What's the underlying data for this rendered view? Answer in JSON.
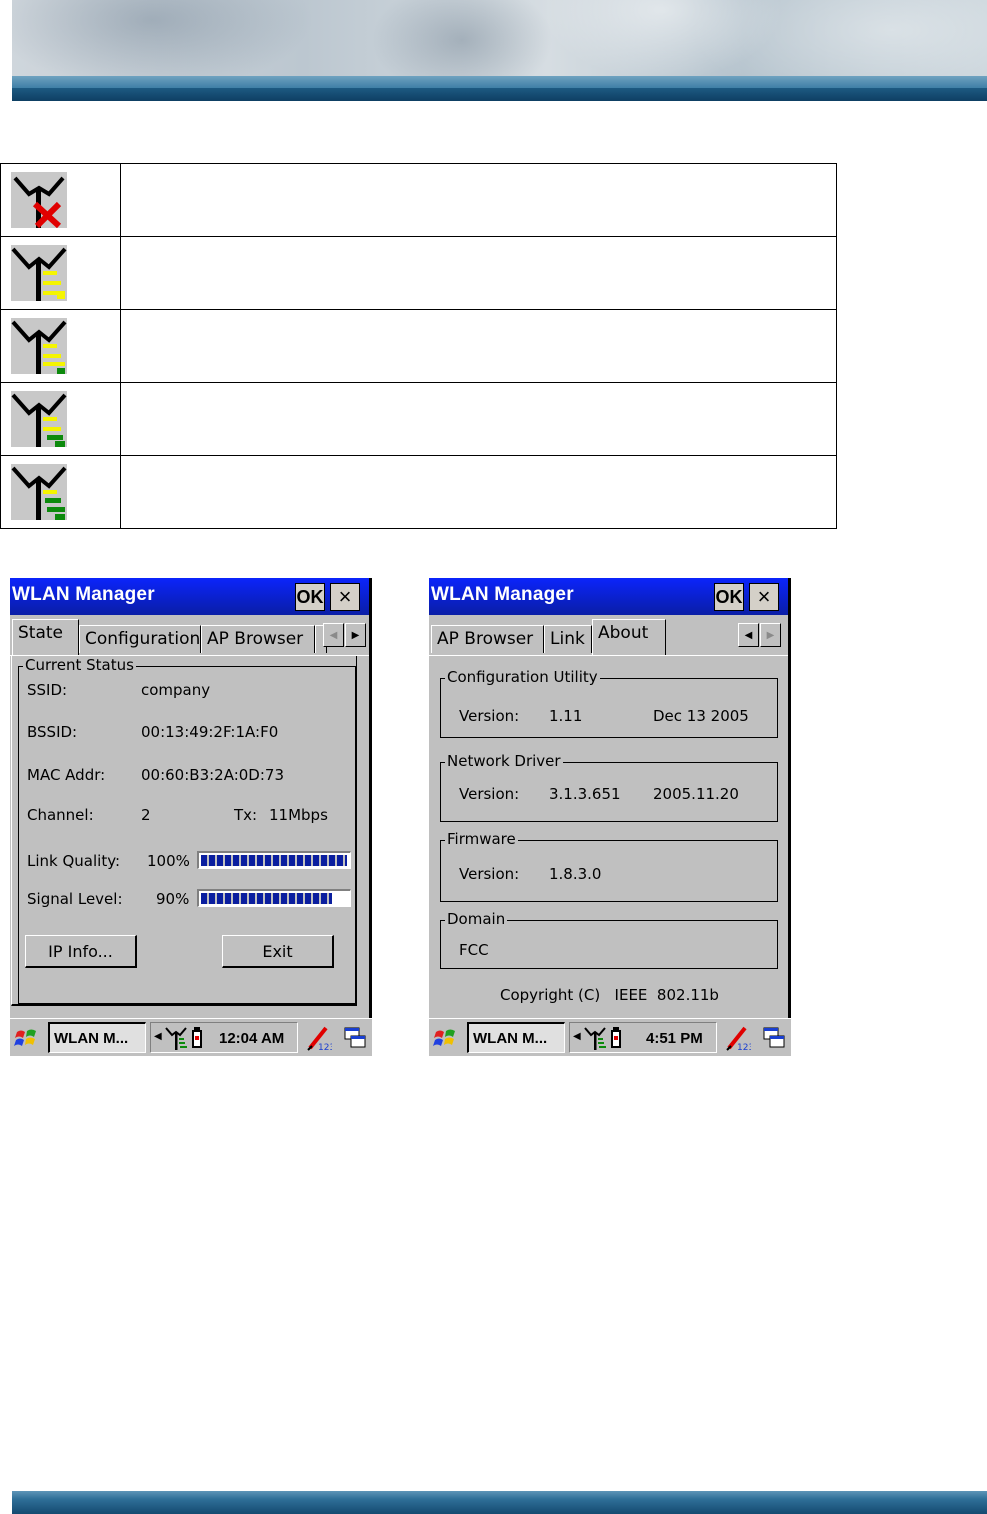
{
  "signal_levels": [
    {
      "icon": "signal-disconnected-icon",
      "description": ""
    },
    {
      "icon": "signal-bars-0-green-icon",
      "description": ""
    },
    {
      "icon": "signal-bars-1-green-icon",
      "description": ""
    },
    {
      "icon": "signal-bars-2-green-icon",
      "description": ""
    },
    {
      "icon": "signal-bars-3-green-icon",
      "description": ""
    }
  ],
  "colors": {
    "title_bar": "#0a1ea6",
    "progress_fill": "#0a1e9f",
    "banner_blue": "#144a70",
    "signal_yellow": "#f5f500",
    "signal_green": "#0c8a0c",
    "signal_red": "#e00000"
  },
  "left_window": {
    "title": "WLAN Manager",
    "ok_label": "OK",
    "close_label": "×",
    "tabs": [
      "State",
      "Configuration",
      "AP Browser"
    ],
    "active_tab": "State",
    "group_title": "Current Status",
    "ssid": {
      "label": "SSID:",
      "value": "company"
    },
    "bssid": {
      "label": "BSSID:",
      "value": "00:13:49:2F:1A:F0"
    },
    "mac": {
      "label": "MAC Addr:",
      "value": "00:60:B3:2A:0D:73"
    },
    "channel": {
      "label": "Channel:",
      "value": "2"
    },
    "tx": {
      "label": "Tx:",
      "value": "11Mbps"
    },
    "link_quality": {
      "label": "Link Quality:",
      "value": "100%",
      "percent": 100
    },
    "signal_level": {
      "label": "Signal Level:",
      "value": "90%",
      "percent": 90
    },
    "ip_info_button": "IP Info...",
    "exit_button": "Exit",
    "taskbar": {
      "task_label": "WLAN M...",
      "clock": "12:04 AM"
    }
  },
  "right_window": {
    "title": "WLAN Manager",
    "ok_label": "OK",
    "close_label": "×",
    "tabs": [
      "AP Browser",
      "Link",
      "About"
    ],
    "active_tab": "About",
    "config_utility": {
      "title": "Configuration Utility",
      "version_label": "Version:",
      "version": "1.11",
      "date": "Dec 13 2005"
    },
    "network_driver": {
      "title": "Network Driver",
      "version_label": "Version:",
      "version": "3.1.3.651",
      "date": "2005.11.20"
    },
    "firmware": {
      "title": "Firmware",
      "version_label": "Version:",
      "version": "1.8.3.0"
    },
    "domain": {
      "title": "Domain",
      "value": "FCC"
    },
    "copyright": "Copyright (C)   IEEE  802.11b",
    "taskbar": {
      "task_label": "WLAN M...",
      "clock": "4:51 PM"
    }
  }
}
